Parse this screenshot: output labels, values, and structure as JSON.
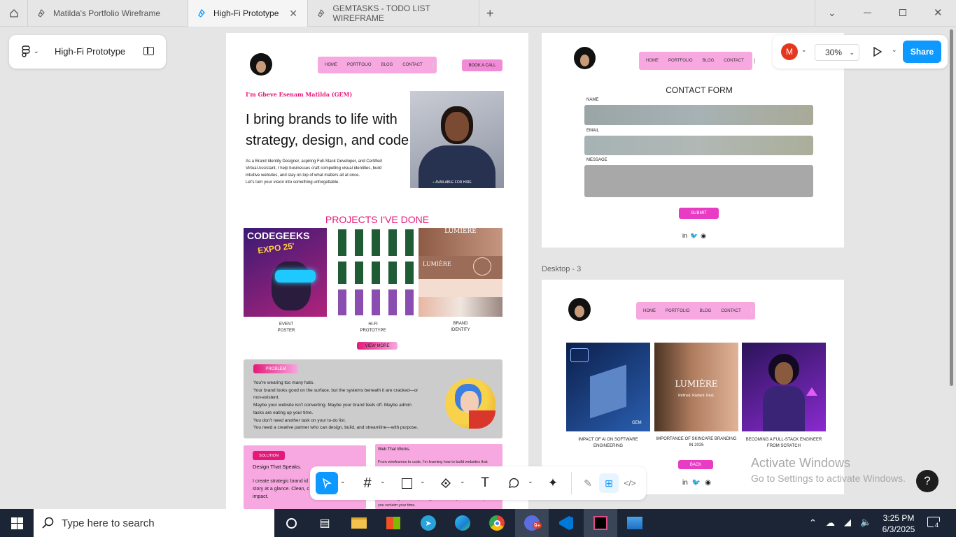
{
  "tabs": [
    {
      "label": "Matilda's Portfolio Wireframe"
    },
    {
      "label": "High-Fi Prototype"
    },
    {
      "label": "GEMTASKS - TODO LIST WIREFRAME"
    }
  ],
  "file_panel": {
    "title": "High-Fi Prototype"
  },
  "share_panel": {
    "avatar": "M",
    "zoom": "30%",
    "share": "Share"
  },
  "nav": {
    "home": "HOME",
    "portfolio": "PORTFOLIO",
    "blog": "BLOG",
    "contact": "CONTACT",
    "book": "BOOK A CALL"
  },
  "hero": {
    "intro": "I'm Gbeve Esenam Matilda (GEM)",
    "headline1": "I bring brands to life with",
    "headline2": "strategy, design, and code.",
    "body1": "As a Brand Identity Designer, aspiring Full-Stack Developer, and Certified",
    "body2": "Virtual Assistant, I help businesses craft compelling visual identities, build",
    "body3": "intuitive websites, and stay on top of what matters all at once.",
    "body4": "Let's turn your vision into something unforgettable.",
    "badge": "AVAILABLE FOR HIRE"
  },
  "projects": {
    "title": "PROJECTS I'VE DONE",
    "poster_title": "CODEGEEKS",
    "poster_sub": "EXPO 25'",
    "cap1a": "EVENT",
    "cap1b": "POSTER",
    "cap2a": "HI-FI",
    "cap2b": "PROTOTYPE",
    "cap3a": "BRAND",
    "cap3b": "IDENTITY",
    "brand_logo": "LUMIÈRE",
    "view_more": "VIEW MORE"
  },
  "problem": {
    "label": "PROBLEM",
    "l1": "You're wearing too many hats.",
    "l2": "Your brand looks good on the surface, but the systems beneath it are cracked—or",
    "l3": "non-existent.",
    "l4": "Maybe your website isn't converting. Maybe your brand feels off. Maybe admin",
    "l5": "tasks are eating up your time.",
    "l6": "You don't need another task on your to-do list.",
    "l7": "You need a creative partner who can design, build, and streamline—with purpose."
  },
  "solution": {
    "label": "SOLUTION",
    "title": "Design That Speaks.",
    "b1": "I create strategic brand id",
    "b2": "story at a glance. Clean, c",
    "b3": "impact."
  },
  "web": {
    "title": "Web That Works.",
    "b1": "From wireframes to code, I'm learning how to build websites that",
    "b2": "inbox management, scheduling, or workflow optimization, I help",
    "b3": "you reclaim your time."
  },
  "contact": {
    "title": "CONTACT FORM",
    "name": "NAME",
    "email": "EMAIL",
    "message": "MESSAGE",
    "submit": "SUBMIT"
  },
  "desktop3": {
    "label": "Desktop - 3",
    "c1a": "IMPACT OF AI ON SOFTWARE",
    "c1b": "ENGINEERING",
    "c2a": "IMPORTANCE OF SKINCARE BRANDING",
    "c2b": "IN 2025",
    "c3a": "BECOMING A FULL-STACK ENGINEER",
    "c3b": "FROM SCRATCH",
    "back": "BACK",
    "gem": "GEM",
    "lumiere": "LUMIÈRE",
    "lumiere_sub": "Refined. Radiant. Real."
  },
  "watermark": {
    "title": "Activate Windows",
    "sub": "Go to Settings to activate Windows."
  },
  "taskbar": {
    "search": "Type here to search",
    "time": "3:25 PM",
    "date": "6/3/2025",
    "notif": "4",
    "badge": "9+"
  },
  "help": "?",
  "colors": {
    "accent": "#0d99ff",
    "pink": "#f7a8e0",
    "magenta": "#e5197a",
    "taskbar": "#1c2536"
  }
}
